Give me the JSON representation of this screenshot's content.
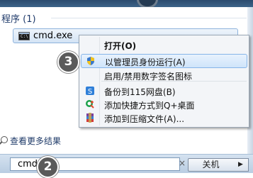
{
  "menu": {
    "section_title": "程序 (1)",
    "program_label": "cmd.exe",
    "program_icon_text": "C:\\",
    "more_results": "查看更多结果"
  },
  "context_menu": {
    "items": [
      {
        "label": "打开(O)",
        "icon": "none"
      },
      {
        "label": "以管理员身份运行(A)",
        "icon": "uac-shield-icon"
      },
      {
        "label": "启用/禁用数字签名图标",
        "icon": "none"
      },
      {
        "label": "备份到115网盘(B)",
        "icon": "115-cloud-icon"
      },
      {
        "label": "添加快捷方式到Q+桌面",
        "icon": "qplus-icon"
      },
      {
        "label": "添加到压缩文件(A)...",
        "icon": "winrar-icon"
      }
    ]
  },
  "search": {
    "value": "cmd",
    "clear_glyph": "×"
  },
  "shutdown": {
    "label": "关机",
    "arrow": "▶"
  },
  "steps": {
    "step2": "2",
    "step3": "3"
  },
  "colors": {
    "highlight": "#cfe4fa",
    "step_circle": "#5a5a5a",
    "section_title": "#1f3a6a"
  }
}
